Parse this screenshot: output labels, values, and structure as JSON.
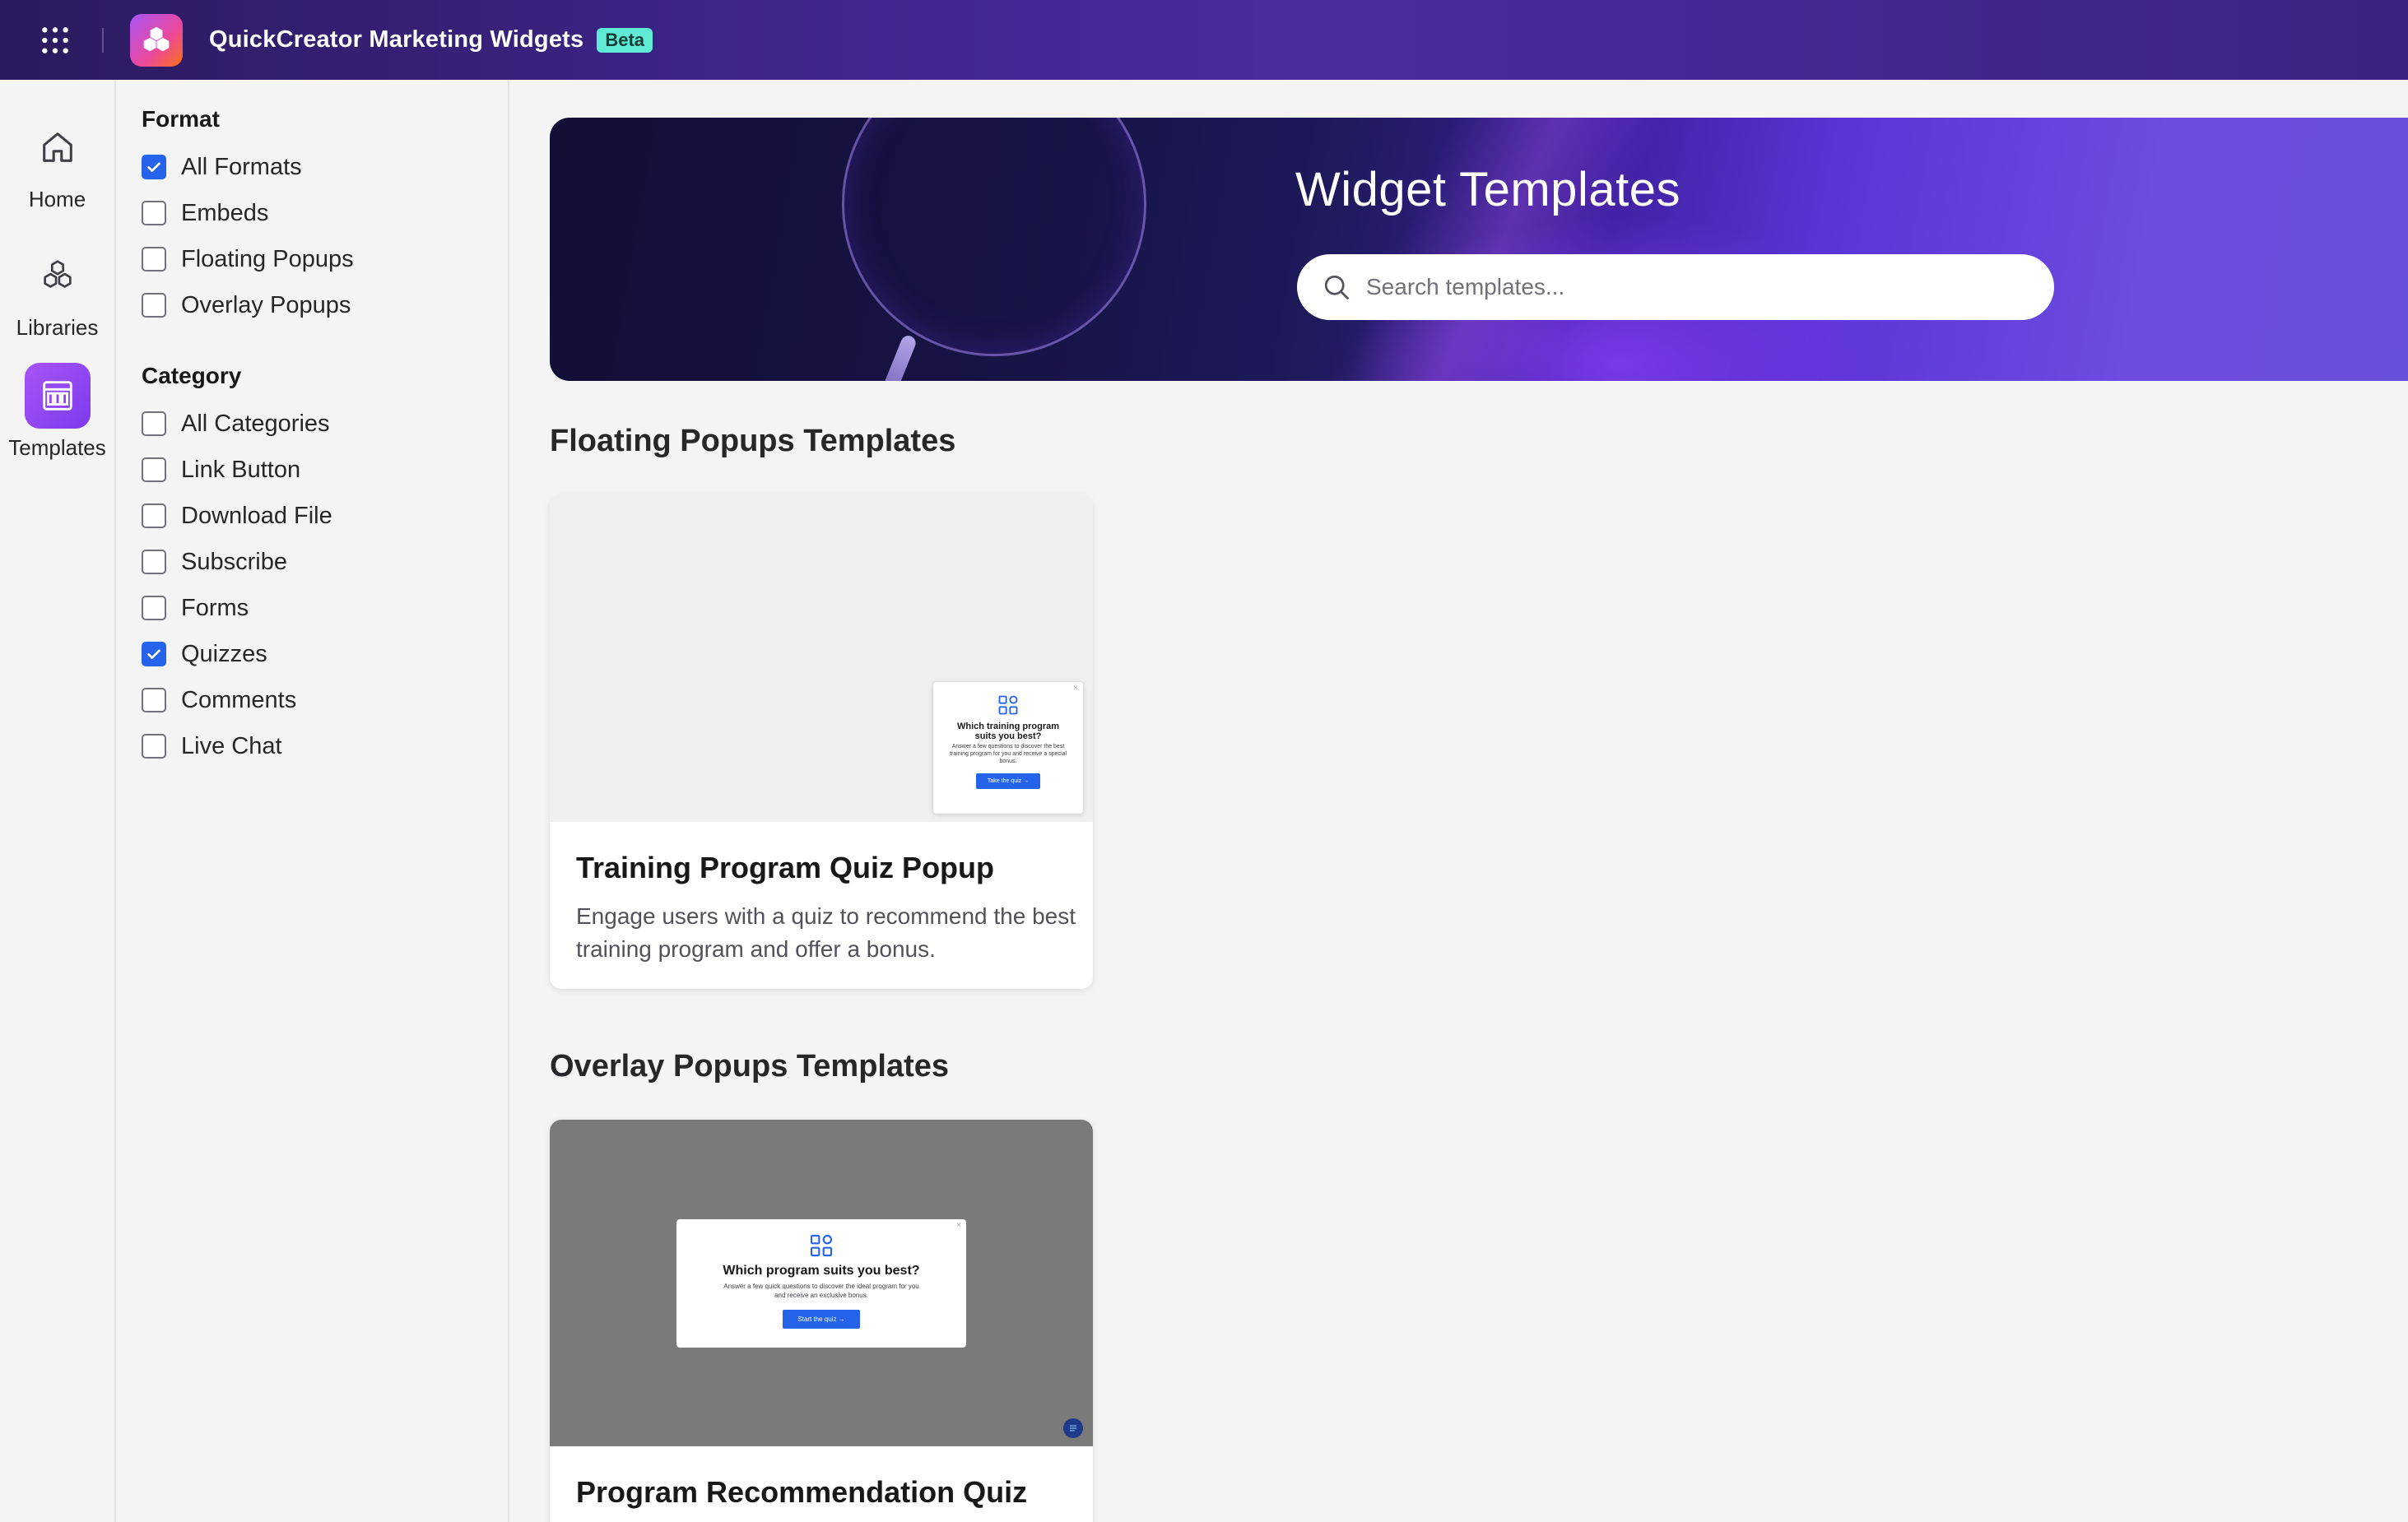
{
  "app": {
    "title": "QuickCreator Marketing Widgets",
    "badge": "Beta"
  },
  "nav": {
    "items": [
      {
        "label": "Home",
        "icon": "home-icon",
        "active": false
      },
      {
        "label": "Libraries",
        "icon": "cubes-icon",
        "active": false
      },
      {
        "label": "Templates",
        "icon": "template-icon",
        "active": true
      }
    ]
  },
  "filters": {
    "format": {
      "heading": "Format",
      "options": [
        {
          "label": "All Formats",
          "checked": true
        },
        {
          "label": "Embeds",
          "checked": false
        },
        {
          "label": "Floating Popups",
          "checked": false
        },
        {
          "label": "Overlay Popups",
          "checked": false
        }
      ]
    },
    "category": {
      "heading": "Category",
      "options": [
        {
          "label": "All Categories",
          "checked": false
        },
        {
          "label": "Link Button",
          "checked": false
        },
        {
          "label": "Download File",
          "checked": false
        },
        {
          "label": "Subscribe",
          "checked": false
        },
        {
          "label": "Forms",
          "checked": false
        },
        {
          "label": "Quizzes",
          "checked": true
        },
        {
          "label": "Comments",
          "checked": false
        },
        {
          "label": "Live Chat",
          "checked": false
        }
      ]
    }
  },
  "hero": {
    "title": "Widget Templates",
    "search_placeholder": "Search templates..."
  },
  "sections": [
    {
      "title": "Floating Popups Templates",
      "cards": [
        {
          "title": "Training Program Quiz Popup",
          "description": "Engage users with a quiz to recommend the best training program and offer a bonus.",
          "preview": {
            "heading": "Which training program suits you best?",
            "text": "Answer a few questions to discover the best training program for you and receive a special bonus.",
            "button": "Take the quiz →"
          }
        }
      ]
    },
    {
      "title": "Overlay Popups Templates",
      "cards": [
        {
          "title": "Program Recommendation Quiz",
          "preview": {
            "heading": "Which program suits you best?",
            "text": "Answer a few quick questions to discover the ideal program for you and receive an exclusive bonus.",
            "button": "Start the quiz →"
          }
        }
      ]
    }
  ],
  "colors": {
    "accent": "#2563eb",
    "brand": "#7c3aed",
    "beta_badge": "#5eead4"
  }
}
